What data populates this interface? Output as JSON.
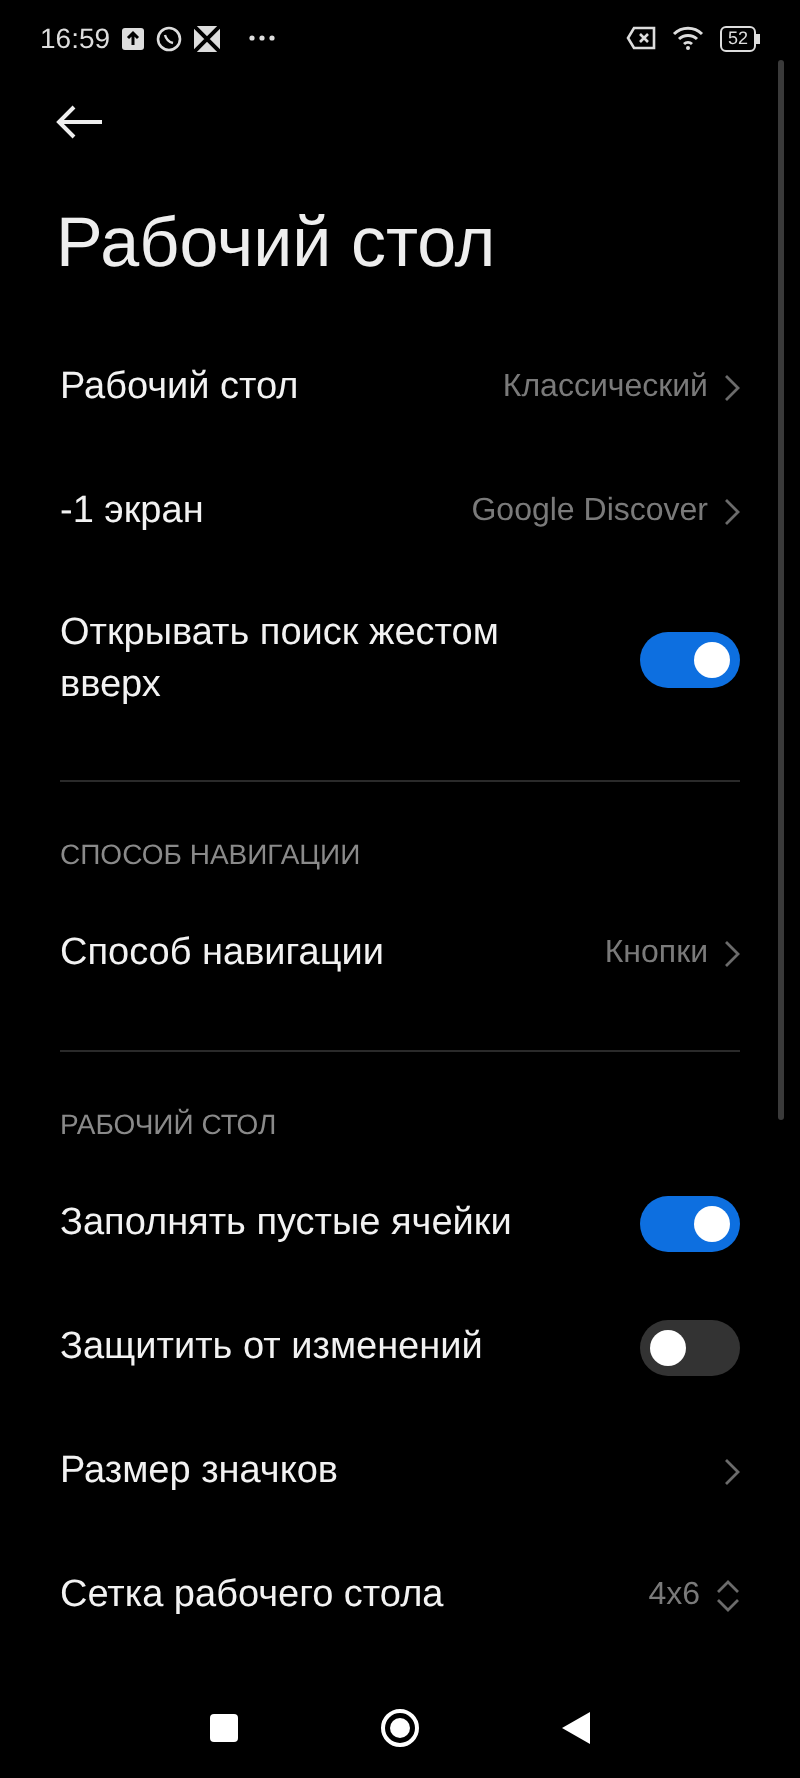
{
  "status_bar": {
    "time": "16:59",
    "battery": "52"
  },
  "title": "Рабочий стол",
  "sections": [
    {
      "items": [
        {
          "kind": "link",
          "label": "Рабочий стол",
          "value": "Классический"
        },
        {
          "kind": "link",
          "label": "-1 экран",
          "value": "Google Discover"
        },
        {
          "kind": "toggle",
          "label": "Открывать поиск жестом вверх",
          "on": true
        }
      ]
    },
    {
      "header": "СПОСОБ НАВИГАЦИИ",
      "items": [
        {
          "kind": "link",
          "label": "Способ навигации",
          "value": "Кнопки"
        }
      ]
    },
    {
      "header": "РАБОЧИЙ СТОЛ",
      "items": [
        {
          "kind": "toggle",
          "label": "Заполнять пустые ячейки",
          "on": true
        },
        {
          "kind": "toggle",
          "label": "Защитить от изменений",
          "on": false
        },
        {
          "kind": "link",
          "label": "Размер значков"
        },
        {
          "kind": "stepper",
          "label": "Сетка рабочего стола",
          "value": "4x6"
        }
      ]
    }
  ]
}
